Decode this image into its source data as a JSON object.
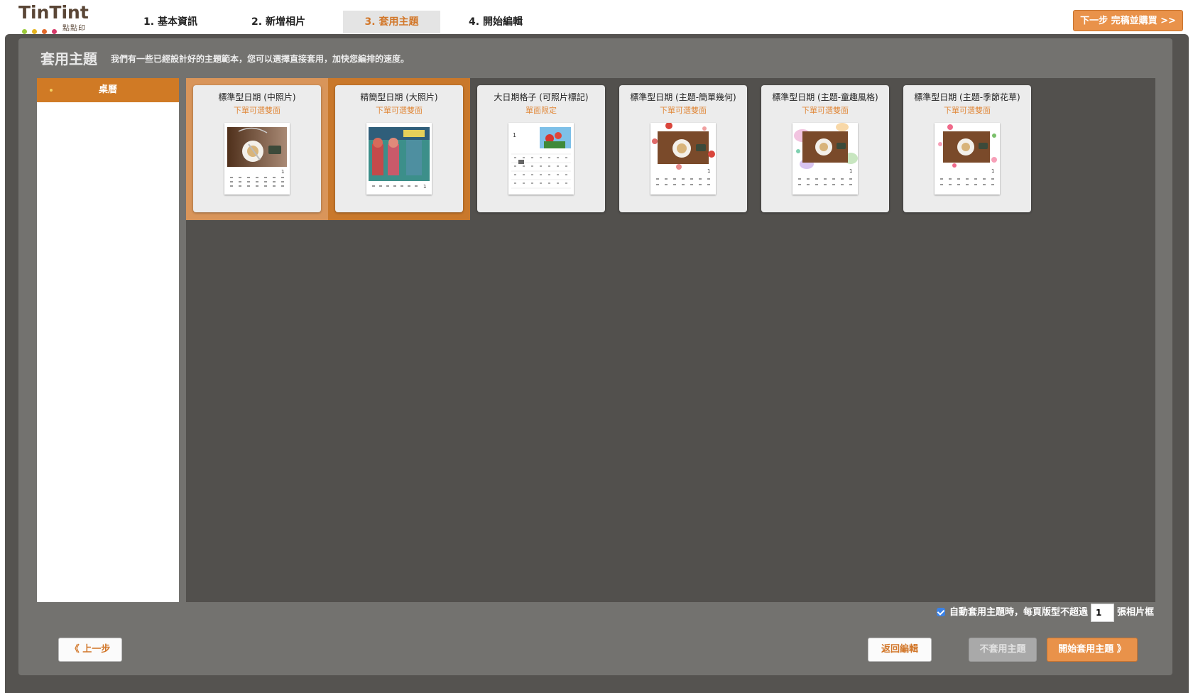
{
  "app": {
    "logo_text": "TinTint",
    "logo_sub": "點點印",
    "logo_dot_colors": [
      "#9cc93a",
      "#e6b41f",
      "#e36a2b",
      "#d73a6a"
    ]
  },
  "steps": [
    {
      "label": "1. 基本資訊",
      "active": false
    },
    {
      "label": "2. 新增相片",
      "active": false
    },
    {
      "label": "3. 套用主題",
      "active": true
    },
    {
      "label": "4. 開始編輯",
      "active": false
    }
  ],
  "next_button": "下一步 完稿並購買 >>",
  "page": {
    "title": "套用主題",
    "description": "我們有一些已經設計好的主題範本，您可以選擇直接套用，加快您編排的速度。"
  },
  "sidebar": {
    "categories": [
      {
        "label": "桌曆",
        "selected": true
      }
    ]
  },
  "themes": [
    {
      "title": "標準型日期 (中照片)",
      "subtitle": "下單可選雙面",
      "state": "hover",
      "thumb": "standard-photo"
    },
    {
      "title": "精簡型日期 (大照片)",
      "subtitle": "下單可選雙面",
      "state": "selected",
      "thumb": "mural-photo"
    },
    {
      "title": "大日期格子 (可照片標記)",
      "subtitle": "單面限定",
      "state": "normal",
      "thumb": "grid-flowers"
    },
    {
      "title": "標準型日期 (主題-簡單幾何)",
      "subtitle": "下單可選雙面",
      "state": "normal",
      "thumb": "geometric"
    },
    {
      "title": "標準型日期 (主題-童趣風格)",
      "subtitle": "下單可選雙面",
      "state": "normal",
      "thumb": "playful"
    },
    {
      "title": "標準型日期 (主題-季節花草)",
      "subtitle": "下單可選雙面",
      "state": "normal",
      "thumb": "seasonal"
    }
  ],
  "auto_apply": {
    "checked": true,
    "label_before": "自動套用主題時，每頁版型不超過",
    "value": "1",
    "label_after": "張相片框"
  },
  "buttons": {
    "prev": "《 上一步",
    "back_to_edit": "返回編輯",
    "no_theme": "不套用主題",
    "apply_theme": "開始套用主題 》"
  },
  "colors": {
    "accent": "#d2772a",
    "selected_card_bg": "#c9782b",
    "frame_dark": "#555350",
    "frame_mid": "#73726f"
  }
}
